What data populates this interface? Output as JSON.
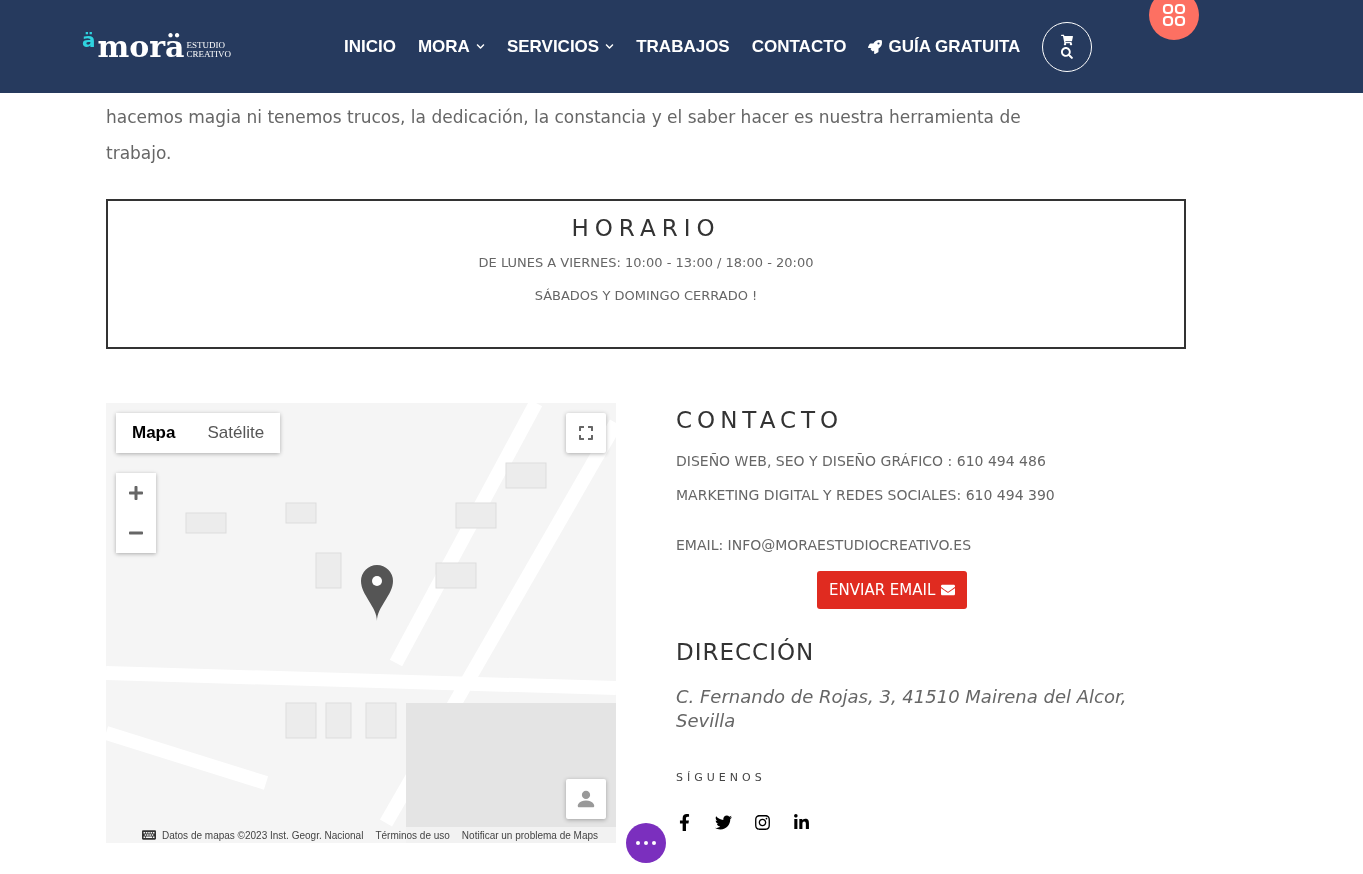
{
  "header": {
    "logo": {
      "mark": "ä",
      "name": "morä",
      "tagline_1": "ESTUDIO",
      "tagline_2": "CREATIVO"
    },
    "nav": [
      {
        "label": "INICIO",
        "kind": "link"
      },
      {
        "label": "MORA",
        "kind": "menu"
      },
      {
        "label": "SERVICIOS",
        "kind": "menu"
      },
      {
        "label": "TRABAJOS",
        "kind": "link"
      },
      {
        "label": "CONTACTO",
        "kind": "link"
      },
      {
        "label": "GUÍA GRATUITA",
        "kind": "cta"
      }
    ]
  },
  "intro": "hacemos magia ni tenemos trucos, la dedicación, la constancia y el saber hacer es nuestra herramienta de trabajo.",
  "horario": {
    "title": "HORARIO",
    "lines": [
      "DE LUNES A VIERNES: 10:00 - 13:00 / 18:00 - 20:00",
      "SÁBADOS Y DOMINGO CERRADO !"
    ]
  },
  "map": {
    "tabs": [
      {
        "label": "Mapa",
        "selected": true
      },
      {
        "label": "Satélite",
        "selected": false
      }
    ],
    "footer": [
      "Datos de mapas ©2023 Inst. Geogr. Nacional",
      "Términos de uso",
      "Notificar un problema de Maps"
    ]
  },
  "contacto": {
    "title": "CONTACTO",
    "lines": [
      "DISEÑO WEB, SEO Y DISEÑO GRÁFICO : 610 494 486",
      "MARKETING DIGITAL Y REDES SOCIALES: 610 494 390"
    ],
    "email": "EMAIL: INFO@MORAESTUDIOCREATIVO.ES",
    "button": "ENVIAR EMAIL"
  },
  "direccion": {
    "title": "DIRECCIÓN",
    "address": "C. Fernando de Rojas, 3, 41510  Mairena del Alcor, Sevilla"
  },
  "social": {
    "title": "SÍGUENOS",
    "networks": [
      {
        "kind": "facebook"
      },
      {
        "kind": "twitter"
      },
      {
        "kind": "instagram"
      },
      {
        "kind": "linkedin"
      }
    ]
  }
}
